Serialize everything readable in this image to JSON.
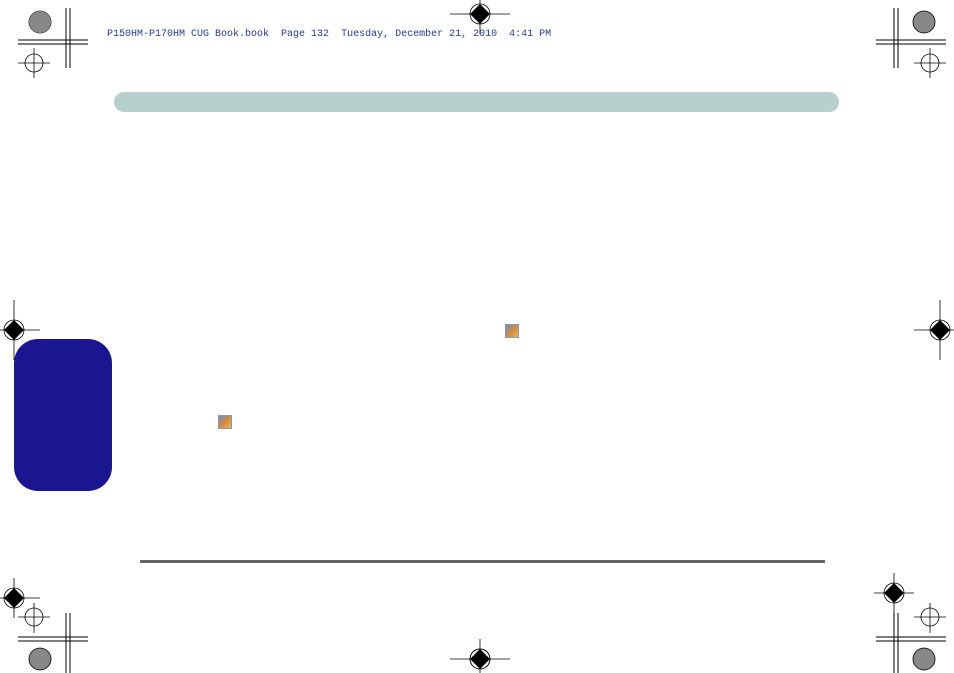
{
  "header": {
    "filename": "P150HM-P170HM CUG Book.book",
    "page": "Page 132",
    "date": "Tuesday, December 21, 2010",
    "time": "4:41 PM"
  }
}
